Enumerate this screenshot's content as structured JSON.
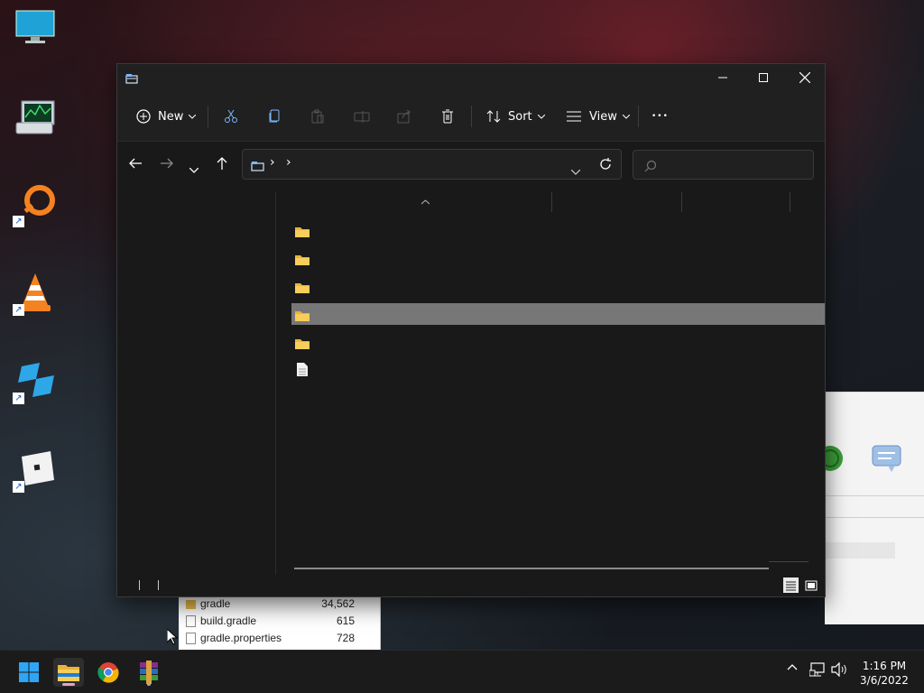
{
  "explorer": {
    "toolbar": {
      "new_label": "New",
      "sort_label": "Sort",
      "view_label": "View",
      "more_label": "•••"
    },
    "address": {
      "separator_1": "›",
      "separator_2": "›"
    },
    "search": {
      "value": ""
    },
    "files": [
      {
        "type": "folder",
        "name": ""
      },
      {
        "type": "folder",
        "name": ""
      },
      {
        "type": "folder",
        "name": ""
      },
      {
        "type": "folder",
        "name": "",
        "selected": true
      },
      {
        "type": "folder",
        "name": ""
      },
      {
        "type": "file",
        "name": ""
      }
    ]
  },
  "background_window": {
    "files": [
      {
        "name": "gradle",
        "size": "34,562",
        "type": "folder"
      },
      {
        "name": "build.gradle",
        "size": "615",
        "type": "file"
      },
      {
        "name": "gradle.properties",
        "size": "728",
        "type": "file"
      }
    ]
  },
  "taskbar": {
    "apps": [
      "start-icon",
      "file-explorer-icon",
      "chrome-icon",
      "winrar-icon"
    ],
    "clock": {
      "time": "1:16 PM",
      "date": "3/6/2022"
    }
  },
  "desktop": {
    "icons": [
      "monitor-icon",
      "task-manager-icon",
      "origin-icon",
      "vlc-icon",
      "roblox-studio-icon",
      "roblox-icon"
    ]
  },
  "colors": {
    "selection": "#777777",
    "folder": "#f4c542",
    "window_bg": "#1c1c1c"
  }
}
